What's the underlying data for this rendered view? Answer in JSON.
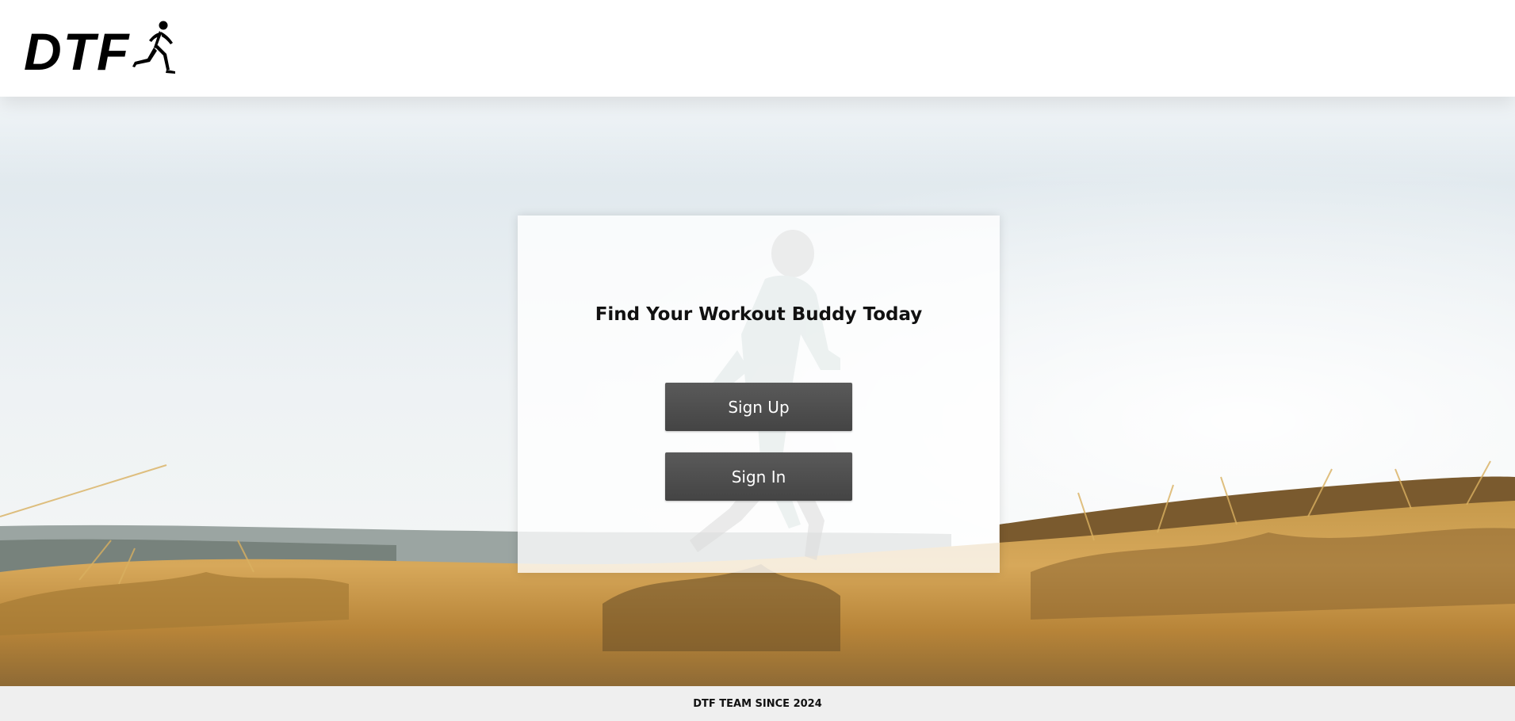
{
  "header": {
    "logo_text": "DTF",
    "logo_icon": "runner-icon"
  },
  "hero": {
    "image_subject": "woman jogging through golden grass field"
  },
  "card": {
    "title": "Find Your Workout Buddy Today",
    "signup_label": "Sign Up",
    "signin_label": "Sign In"
  },
  "footer": {
    "text": "DTF TEAM SINCE 2024"
  },
  "colors": {
    "button_bg": "#4f4f4f",
    "button_text": "#ffffff",
    "sky": "#e9eff2",
    "grass": "#c99a45",
    "footer_bg": "#ebebeb"
  }
}
